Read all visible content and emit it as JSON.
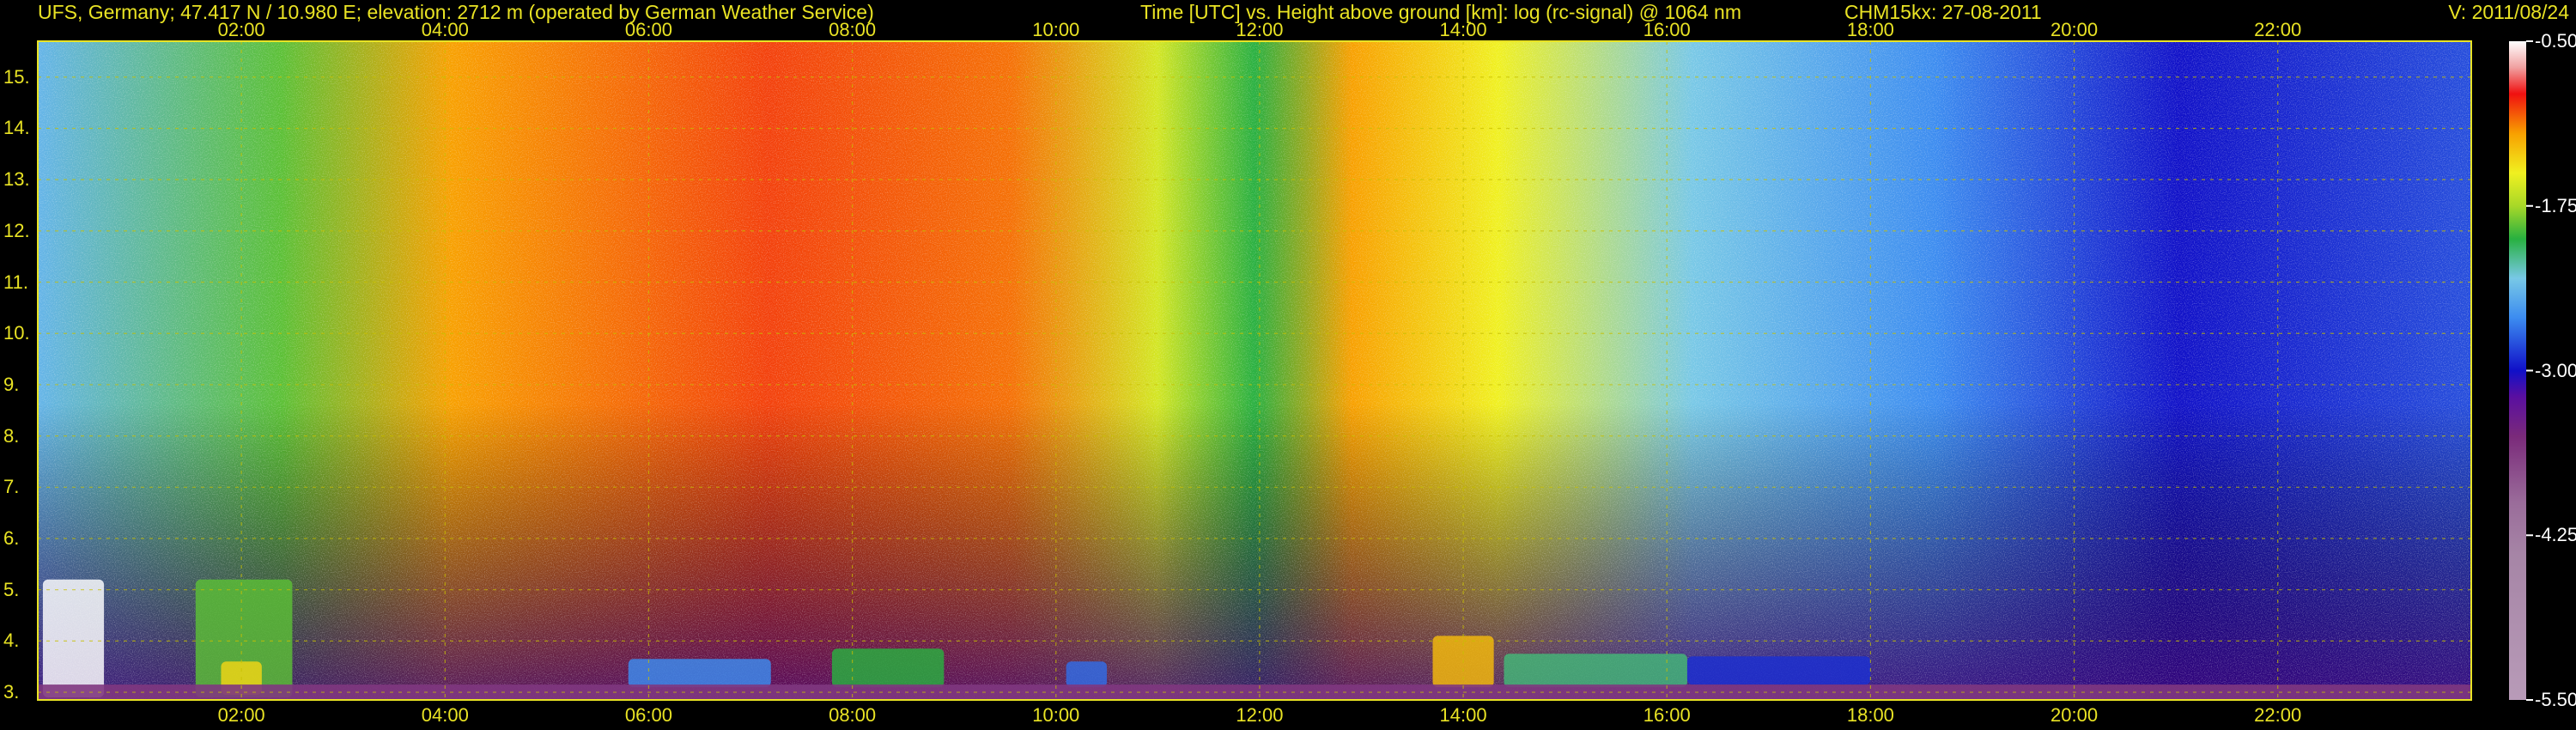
{
  "header": {
    "station": "UFS, Germany; 47.417 N / 10.980 E; elevation: 2712 m  (operated by German Weather Service)",
    "axes_description": "Time [UTC] vs. Height above ground [km]: log (rc-signal) @ 1064 nm",
    "instrument": "CHM15kx: 27-08-2011",
    "version_label": "V:",
    "version_value": "2011/08/24"
  },
  "colors": {
    "background": "#000000",
    "text": "#e9e324",
    "grid": "#c8c000",
    "colorbar_labels": "#ffffff"
  },
  "chart_data": {
    "type": "heatmap",
    "title": "Time [UTC] vs. Height above ground [km]: log (rc-signal) @ 1064 nm",
    "xlabel": "Time [UTC]",
    "ylabel": "Height above ground [km]",
    "x_unit": "hours UTC",
    "xlim": [
      0.0,
      23.9
    ],
    "ylim": [
      2.85,
      15.7
    ],
    "x_ticks": [
      {
        "value": 2,
        "label": "02:00"
      },
      {
        "value": 4,
        "label": "04:00"
      },
      {
        "value": 6,
        "label": "06:00"
      },
      {
        "value": 8,
        "label": "08:00"
      },
      {
        "value": 10,
        "label": "10:00"
      },
      {
        "value": 12,
        "label": "12:00"
      },
      {
        "value": 14,
        "label": "14:00"
      },
      {
        "value": 16,
        "label": "16:00"
      },
      {
        "value": 18,
        "label": "18:00"
      },
      {
        "value": 20,
        "label": "20:00"
      },
      {
        "value": 22,
        "label": "22:00"
      }
    ],
    "y_ticks": [
      {
        "value": 3,
        "label": "3."
      },
      {
        "value": 4,
        "label": "4."
      },
      {
        "value": 5,
        "label": "5."
      },
      {
        "value": 6,
        "label": "6."
      },
      {
        "value": 7,
        "label": "7."
      },
      {
        "value": 8,
        "label": "8."
      },
      {
        "value": 9,
        "label": "9."
      },
      {
        "value": 10,
        "label": "10."
      },
      {
        "value": 11,
        "label": "11."
      },
      {
        "value": 12,
        "label": "12."
      },
      {
        "value": 13,
        "label": "13."
      },
      {
        "value": 14,
        "label": "14."
      },
      {
        "value": 15,
        "label": "15."
      }
    ],
    "grid": true,
    "colorbar": {
      "min": -5.5,
      "max": -0.5,
      "ticks": [
        {
          "value": -0.5,
          "label": "-0.50"
        },
        {
          "value": -1.75,
          "label": "-1.75"
        },
        {
          "value": -3.0,
          "label": "-3.00"
        },
        {
          "value": -4.25,
          "label": "-4.25"
        },
        {
          "value": -5.5,
          "label": "-5.50"
        }
      ],
      "stops": [
        {
          "value": -5.5,
          "color": "#b89bb8"
        },
        {
          "value": -4.4,
          "color": "#a685a6"
        },
        {
          "value": -4.0,
          "color": "#9a6c9a"
        },
        {
          "value": -3.5,
          "color": "#7a2a7a"
        },
        {
          "value": -3.2,
          "color": "#5a0fa0"
        },
        {
          "value": -3.0,
          "color": "#1010c8"
        },
        {
          "value": -2.6,
          "color": "#3c8cf0"
        },
        {
          "value": -2.3,
          "color": "#78c8e6"
        },
        {
          "value": -2.0,
          "color": "#28b040"
        },
        {
          "value": -1.75,
          "color": "#a8d828"
        },
        {
          "value": -1.5,
          "color": "#f0f020"
        },
        {
          "value": -1.2,
          "color": "#f8a000"
        },
        {
          "value": -0.9,
          "color": "#f01010"
        },
        {
          "value": -0.7,
          "color": "#f0a0a0"
        },
        {
          "value": -0.5,
          "color": "#ffffff"
        }
      ]
    },
    "features": [
      {
        "kind": "cloud",
        "x0": 0.05,
        "x1": 0.65,
        "y0": 2.9,
        "y1": 5.2,
        "value": -0.5
      },
      {
        "kind": "cloud",
        "x0": 1.55,
        "x1": 2.5,
        "y0": 2.9,
        "y1": 5.2,
        "value": -1.9
      },
      {
        "kind": "cloud",
        "x0": 1.8,
        "x1": 2.2,
        "y0": 2.95,
        "y1": 3.6,
        "value": -1.4
      },
      {
        "kind": "cloud",
        "x0": 5.8,
        "x1": 7.2,
        "y0": 3.1,
        "y1": 3.65,
        "value": -2.6
      },
      {
        "kind": "cloud",
        "x0": 7.8,
        "x1": 8.9,
        "y0": 3.1,
        "y1": 3.85,
        "value": -2.0
      },
      {
        "kind": "cloud",
        "x0": 10.1,
        "x1": 10.5,
        "y0": 3.1,
        "y1": 3.6,
        "value": -2.7
      },
      {
        "kind": "cloud",
        "x0": 13.7,
        "x1": 14.3,
        "y0": 3.1,
        "y1": 4.1,
        "value": -1.3
      },
      {
        "kind": "cloud",
        "x0": 14.4,
        "x1": 16.2,
        "y0": 3.1,
        "y1": 3.75,
        "value": -2.1
      },
      {
        "kind": "cloud",
        "x0": 16.2,
        "x1": 18.0,
        "y0": 3.15,
        "y1": 3.7,
        "value": -2.9
      },
      {
        "kind": "layer",
        "x0": 0.0,
        "x1": 23.9,
        "y0": 2.85,
        "y1": 3.15,
        "value": -3.6
      }
    ]
  }
}
